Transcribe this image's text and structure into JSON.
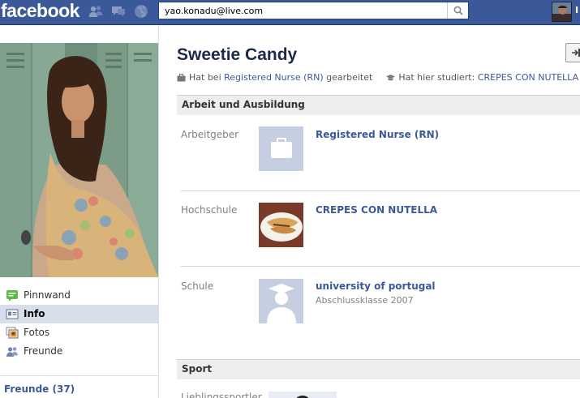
{
  "topbar": {
    "logo": "facebook",
    "search_value": "yao.konadu@live.com",
    "user_initial": "I"
  },
  "profile": {
    "name": "Sweetie Candy",
    "headline": {
      "work_prefix": "Hat bei",
      "work_link": "Registered Nurse (RN)",
      "work_suffix": "gearbeitet",
      "study_prefix": "Hat hier studiert:",
      "study_link": "CREPES CON NUTELLA"
    }
  },
  "left_nav": {
    "items": [
      {
        "label": "Pinnwand",
        "icon": "wall-icon"
      },
      {
        "label": "Info",
        "icon": "info-icon",
        "active": true
      },
      {
        "label": "Fotos",
        "icon": "photos-icon"
      },
      {
        "label": "Freunde",
        "icon": "friends-icon"
      }
    ],
    "friends_count": "Freunde (37)"
  },
  "sections": {
    "work": {
      "header": "Arbeit und Ausbildung",
      "rows": [
        {
          "label": "Arbeitgeber",
          "title": "Registered Nurse (RN)",
          "subtitle": ""
        },
        {
          "label": "Hochschule",
          "title": "CREPES CON NUTELLA",
          "subtitle": ""
        },
        {
          "label": "Schule",
          "title": "university of portugal",
          "subtitle": "Abschlussklasse 2007"
        }
      ]
    },
    "sport": {
      "header": "Sport",
      "next_label": "Lieblingssportler"
    }
  },
  "colors": {
    "brand_blue": "#3b5998",
    "active_nav_bg": "#d8dfea",
    "section_header_bg": "#eeeeee",
    "label_gray": "#808080"
  }
}
